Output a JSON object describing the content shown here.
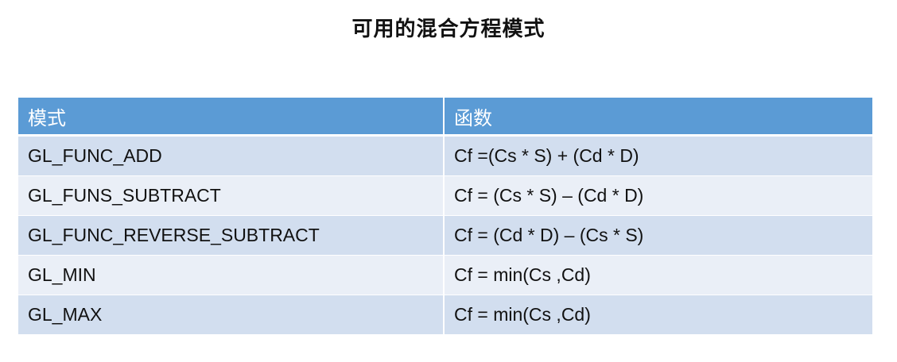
{
  "title": "可用的混合方程模式",
  "table": {
    "headers": [
      "模式",
      "函数"
    ],
    "rows": [
      {
        "mode": "GL_FUNC_ADD",
        "function": "Cf =(Cs * S) + (Cd * D)"
      },
      {
        "mode": "GL_FUNS_SUBTRACT",
        "function": "Cf = (Cs * S) – (Cd * D)"
      },
      {
        "mode": "GL_FUNC_REVERSE_SUBTRACT",
        "function": "Cf = (Cd * D) – (Cs * S)"
      },
      {
        "mode": "GL_MIN",
        "function": "Cf = min(Cs ,Cd)"
      },
      {
        "mode": "GL_MAX",
        "function": "Cf = min(Cs ,Cd)"
      }
    ]
  },
  "colors": {
    "header_bg": "#5b9bd5",
    "row_odd_bg": "#d2deef",
    "row_even_bg": "#eaeff7"
  }
}
